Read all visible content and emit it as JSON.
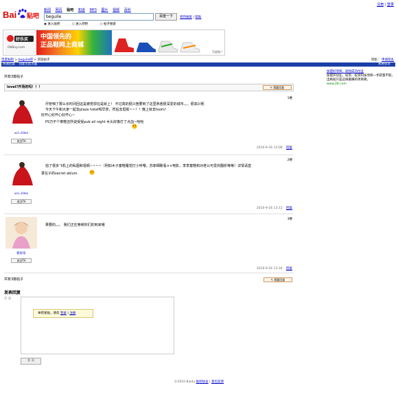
{
  "top_links": {
    "register": "注册",
    "login": "登录"
  },
  "logo": {
    "text_left": "Bai",
    "text_right": "贴吧"
  },
  "nav": [
    "新闻",
    "网页",
    "贴吧",
    "知道",
    "MP3",
    "图片",
    "视频",
    "百科"
  ],
  "search": {
    "value": "beguile",
    "button": "百度一下",
    "adv": "吧内搜索",
    "help": "帮助"
  },
  "radios": [
    "进入贴吧",
    "进入吧吧",
    "帖子搜索"
  ],
  "ad": {
    "brand": "好乐买",
    "brand_url": "OkBuy.com",
    "headline1": "中国领先的",
    "headline2": "正品鞋网上商城",
    "tag": "百度推广"
  },
  "crumb": {
    "home": "百度贴吧",
    "bar": "beguile吧",
    "page": "浏览帖子",
    "right_label": "吧主：",
    "right_link": "申请吧主"
  },
  "bluebar": {
    "a": "快速回复",
    "b": "回复至此页面",
    "right": "我要投诉"
  },
  "right_ad": {
    "title": "加盟好项目，就找成功创业",
    "body": "加盟开创业，投资、投资科技项目一手获量不取，出格就只是这样最赚的项目库。",
    "url": "www.28.com"
  },
  "total": "共有3篇帖子",
  "thread_title": "lovel?开场的吗！！！",
  "reply_btn": "我要回复",
  "posts": [
    {
      "user": "xcl=lilles",
      "follow": "关注TA",
      "floor": "1楼",
      "lines": [
        "尽管咱了那么长时间回这是被党现在是就上！ 不过真的很兴奋要到了这里熟悉很深爱的城市。。。很高兴呢",
        "今天下午和大家一起去plaza hotel喝早茶，然后去逛街~~！！晚上就去toom！",
        "好开心好开心好开心~",
        "PS万不个菜鞋还所说受受pub all night 木头好像打了点血~哈哈"
      ],
      "time": "2010-9-16 13:08",
      "reply": "回复"
    },
    {
      "user": "xcl=lilles",
      "follow": "关注TA",
      "floor": "2楼",
      "lines": [
        "拍了很多飞机上的私图和视频~~~~（例如木子童鞋睡觉打小呼噜，苏菲细致看××电影，李李童鞋和对老公可爱的翻折等等）详情请直",
        "录在子的secret ablum"
      ],
      "time": "2010-9-16 13:13",
      "reply": "回复"
    },
    {
      "user": "新好乐",
      "follow": "关注TA",
      "floor": "3楼",
      "lines": [
        "果要的。。。 我们正在等候你们的到来哦"
      ],
      "time": "2010-9-16 13:34",
      "reply": "回复"
    }
  ],
  "bottom_total": "共有3篇帖子",
  "reply": {
    "title": "发表回复",
    "label": "内  容",
    "tip_prefix": "本吧发贴，请先",
    "login": "登录",
    "sep": "|",
    "register": "注册",
    "submit": "发 表"
  },
  "footer": {
    "copy": "©2010 Baidu",
    "terms": "贴吧协议",
    "feedback": "意见反馈"
  }
}
